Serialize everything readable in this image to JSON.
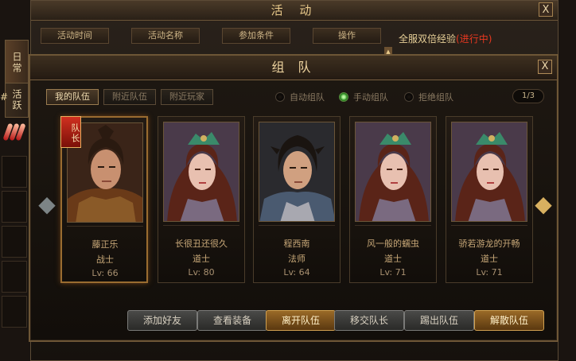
{
  "background_window": {
    "title": "活 动",
    "close": "X",
    "tabs": [
      "活动时间",
      "活动名称",
      "参加条件",
      "操作"
    ],
    "promo_text": "全服双倍经验",
    "promo_status": "(进行中)",
    "scroll_up": "▲"
  },
  "side_tabs": [
    {
      "label": "日常"
    },
    {
      "label": "活跃"
    }
  ],
  "edge_mark": "#",
  "team_panel": {
    "title": "组 队",
    "close": "X",
    "tabs": [
      {
        "label": "我的队伍"
      },
      {
        "label": "附近队伍"
      },
      {
        "label": "附近玩家"
      }
    ],
    "radio_options": [
      {
        "label": "自动组队",
        "selected": false
      },
      {
        "label": "手动组队",
        "selected": true
      },
      {
        "label": "拒绝组队",
        "selected": false
      }
    ],
    "page_indicator": "1/3",
    "prev_arrow": "◆",
    "next_arrow": "◆",
    "leader_badge": "队长",
    "members": [
      {
        "name": "藤正乐",
        "job": "战士",
        "level": "Lv: 66",
        "leader": true
      },
      {
        "name": "长很丑还很久",
        "job": "道士",
        "level": "Lv: 80",
        "leader": false
      },
      {
        "name": "程西南",
        "job": "法师",
        "level": "Lv: 64",
        "leader": false
      },
      {
        "name": "风一般的蠕虫",
        "job": "道士",
        "level": "Lv: 71",
        "leader": false
      },
      {
        "name": "骄若游龙的开畅",
        "job": "道士",
        "level": "Lv: 71",
        "leader": false
      }
    ],
    "buttons": {
      "add_friend": "添加好友",
      "view_equipment": "查看装备",
      "leave_team": "离开队伍",
      "transfer_leader": "移交队长",
      "kick_member": "踢出队伍",
      "disband": "解散队伍"
    }
  }
}
